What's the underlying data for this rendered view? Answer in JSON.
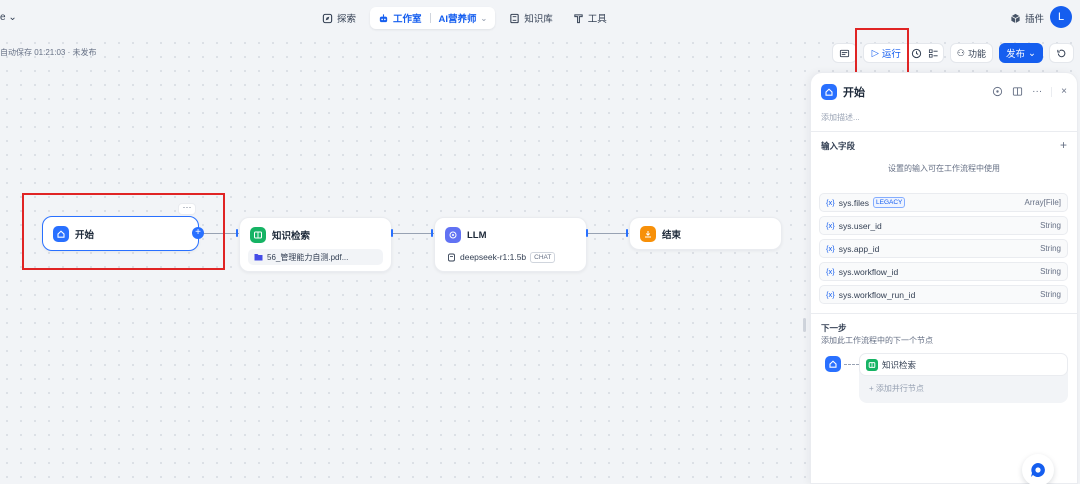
{
  "header": {
    "app_name": "e",
    "nav": {
      "explore": "探索",
      "studio": "工作室",
      "app": "AI营养师",
      "knowledge": "知识库",
      "tools": "工具"
    },
    "plugin": "插件",
    "avatar": "L"
  },
  "autosave": "自动保存 01:21:03 · 未发布",
  "toolbar": {
    "run": "运行",
    "features": "功能",
    "publish": "发布"
  },
  "nodes": {
    "start": {
      "title": "开始",
      "more": "···"
    },
    "knowledge": {
      "title": "知识检索",
      "file": "56_管理能力自测.pdf..."
    },
    "llm": {
      "title": "LLM",
      "model": "deepseek-r1:1.5b",
      "tag": "CHAT"
    },
    "end": {
      "title": "结束"
    }
  },
  "panel": {
    "title": "开始",
    "description_placeholder": "添加描述...",
    "input_fields_title": "输入字段",
    "input_hint": "设置的输入可在工作流程中使用",
    "variables": [
      {
        "name": "sys.files",
        "legacy": "LEGACY",
        "type": "Array[File]"
      },
      {
        "name": "sys.user_id",
        "type": "String"
      },
      {
        "name": "sys.app_id",
        "type": "String"
      },
      {
        "name": "sys.workflow_id",
        "type": "String"
      },
      {
        "name": "sys.workflow_run_id",
        "type": "String"
      }
    ],
    "var_brace": "{x}",
    "next_title": "下一步",
    "next_desc": "添加此工作流程中的下一个节点",
    "next_node": "知识检索",
    "add_parallel": "+ 添加并行节点"
  },
  "colors": {
    "accent": "#155eef",
    "start_icon": "#2970ff",
    "knowledge_icon": "#16b364",
    "llm_icon": "#6172f3",
    "end_icon": "#f79009",
    "highlight": "#e02424"
  }
}
